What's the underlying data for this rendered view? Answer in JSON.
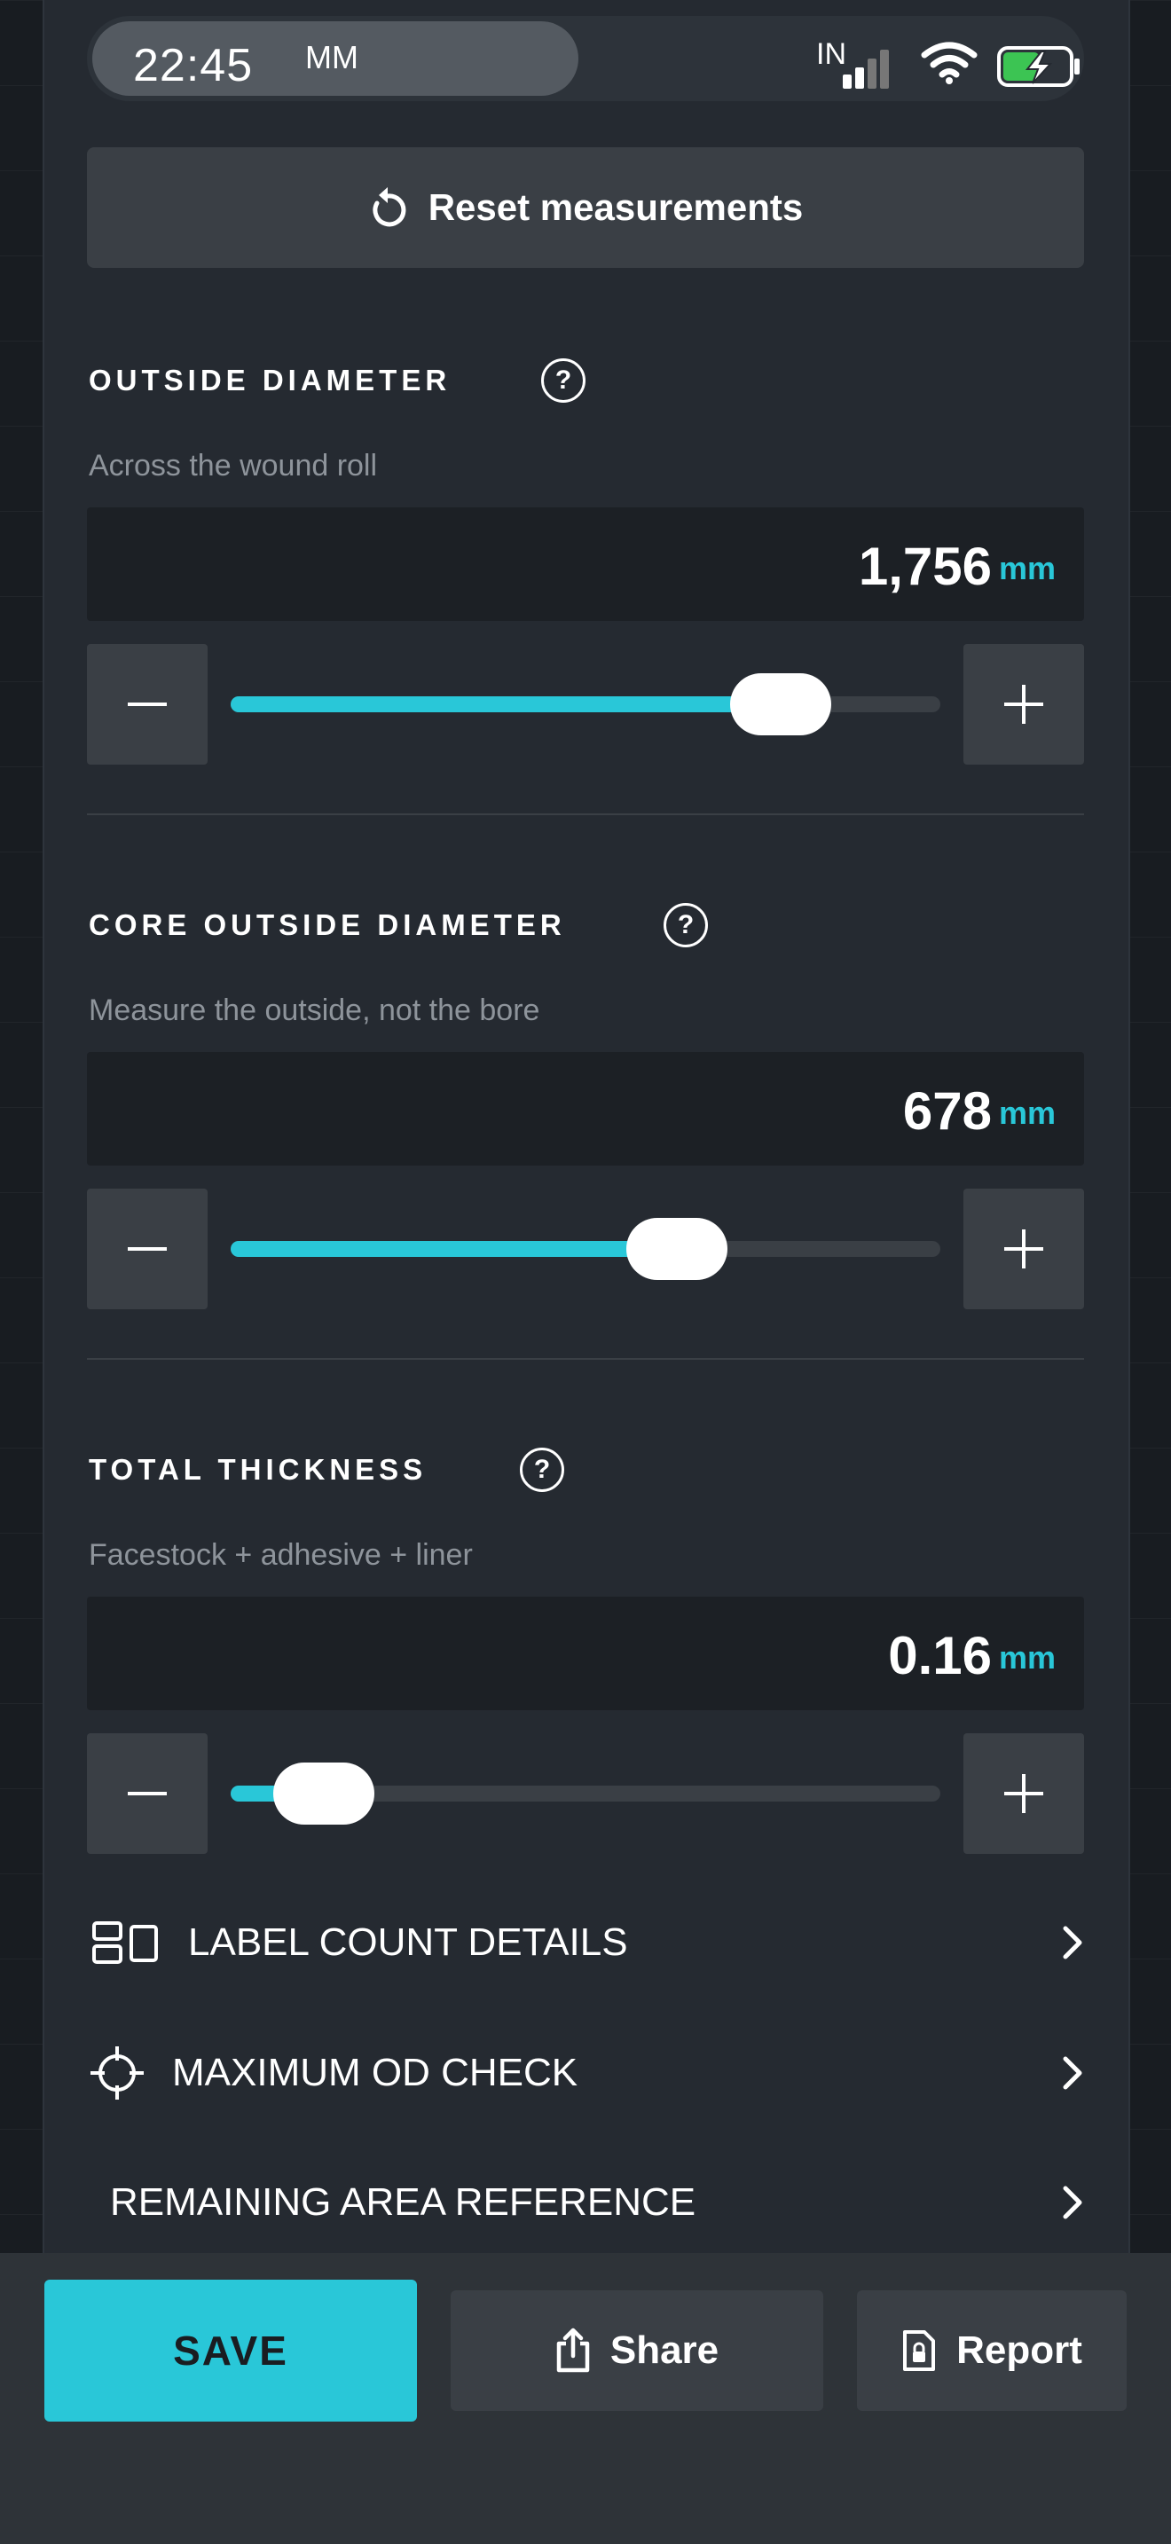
{
  "status_bar": {
    "time": "22:45",
    "carrier": "MM",
    "network": "IN"
  },
  "reset_label": "Reset measurements",
  "sections": [
    {
      "title": "OUTSIDE DIAMETER",
      "subtitle": "Across the wound roll",
      "value": "1,756",
      "unit": "mm",
      "slider_fraction": 0.82
    },
    {
      "title": "CORE OUTSIDE DIAMETER",
      "subtitle": "Measure the outside, not the bore",
      "value": "678",
      "unit": "mm",
      "slider_fraction": 0.65
    },
    {
      "title": "TOTAL THICKNESS",
      "subtitle": "Facestock + adhesive + liner",
      "value": "0.16",
      "unit": "mm",
      "slider_fraction": 0.07
    }
  ],
  "help_glyph": "?",
  "nav": [
    {
      "label": "LABEL COUNT DETAILS",
      "icon": "label-grid-icon"
    },
    {
      "label": "MAXIMUM OD CHECK",
      "icon": "crosshair-icon"
    },
    {
      "label": "REMAINING AREA REFERENCE",
      "icon": ""
    }
  ],
  "actions": {
    "save": "SAVE",
    "share": "Share",
    "report": "Report"
  },
  "colors": {
    "accent": "#29c7d8",
    "panel": "#252a31",
    "input": "#1c2025",
    "button": "#3a3f45"
  }
}
